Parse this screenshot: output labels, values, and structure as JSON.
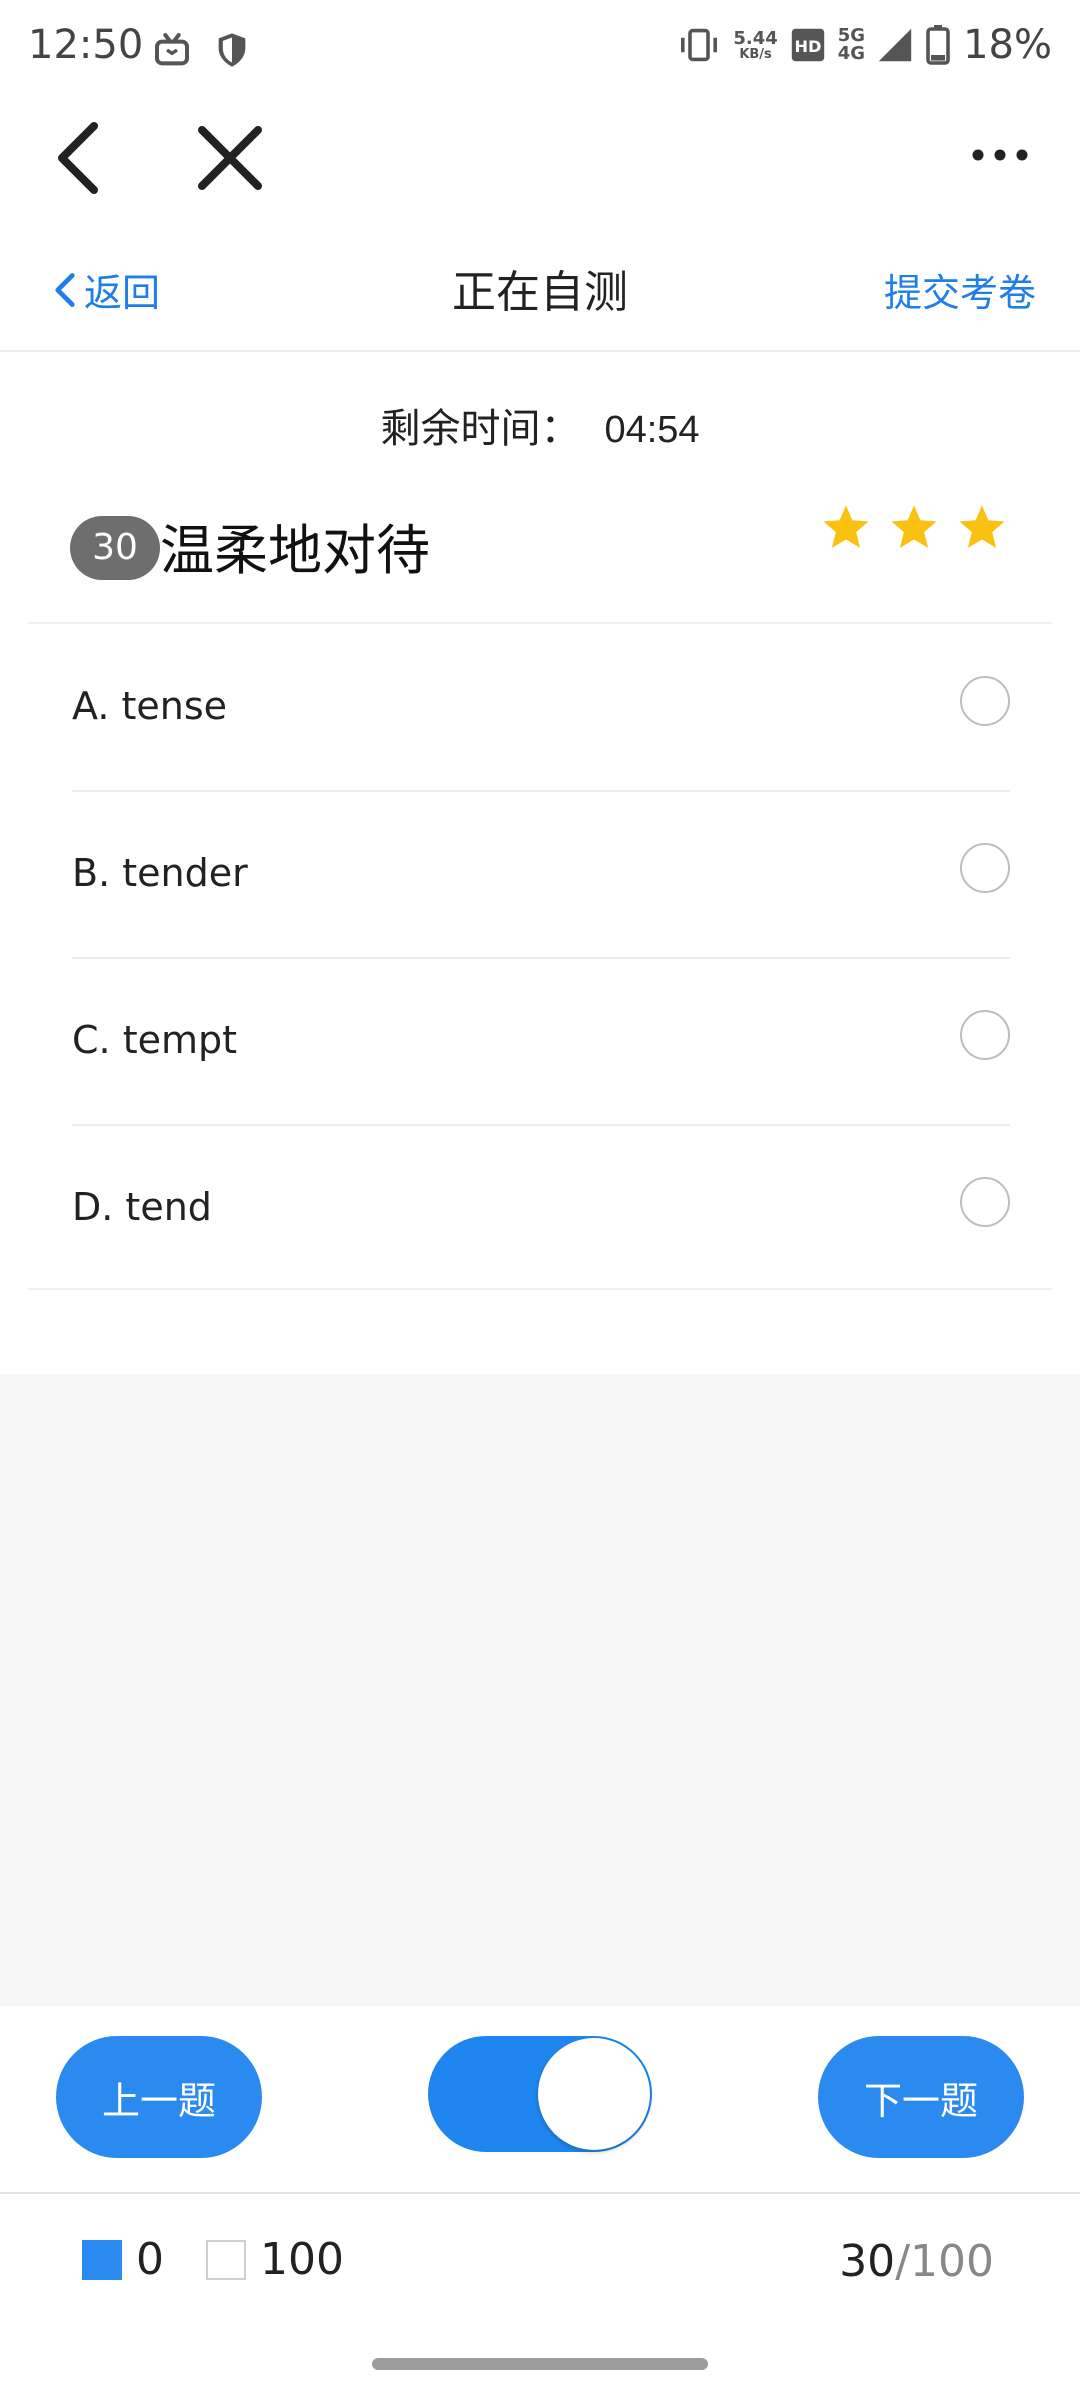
{
  "status_bar": {
    "time": "12:50",
    "network_speed_value": "5.44",
    "network_speed_unit": "KB/s",
    "network_badge_top": "5G",
    "network_badge_bottom": "4G",
    "battery": "18%"
  },
  "header": {
    "back_label": "返回",
    "title": "正在自测",
    "submit_label": "提交考卷"
  },
  "timer": {
    "label": "剩余时间：",
    "value": "04:54"
  },
  "question": {
    "number": "30",
    "text": "温柔地对待",
    "stars": 3
  },
  "options": [
    {
      "label": "A. tense"
    },
    {
      "label": "B. tender"
    },
    {
      "label": "C. tempt"
    },
    {
      "label": "D. tend"
    }
  ],
  "controls": {
    "prev_label": "上一题",
    "next_label": "下一题",
    "toggle_on": true
  },
  "footer": {
    "answered_count": "0",
    "unanswered_count": "100",
    "current": "30",
    "total": "/100"
  },
  "colors": {
    "accent": "#2b8af0",
    "star": "#fbc111",
    "badge": "#6e6e6e"
  }
}
